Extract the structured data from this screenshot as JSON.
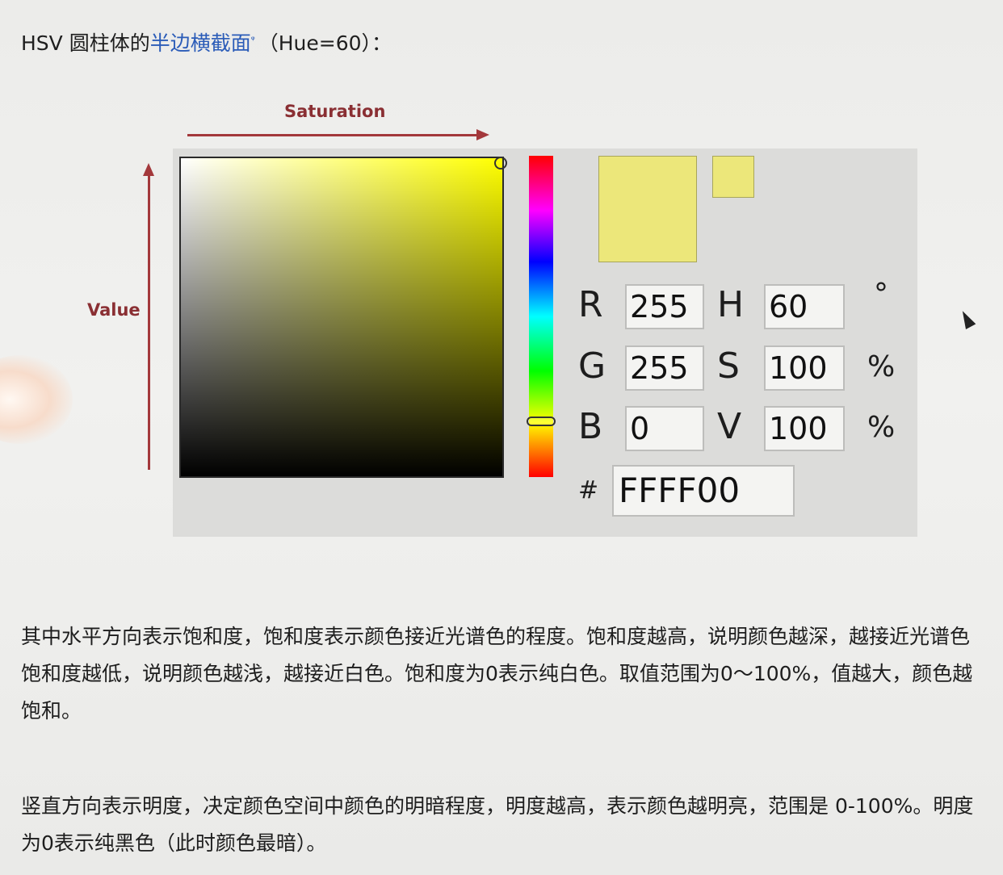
{
  "heading": {
    "prefix": "HSV 圆柱体的",
    "link_text": "半边横截面",
    "search_glyph": "ᵠ",
    "suffix": "（Hue=60）："
  },
  "diagram": {
    "saturation_label": "Saturation",
    "value_label": "Value"
  },
  "picker": {
    "color_hex": "#ece77a",
    "rgb": {
      "r_label": "R",
      "r_value": "255",
      "g_label": "G",
      "g_value": "255",
      "b_label": "B",
      "b_value": "0"
    },
    "hsv": {
      "h_label": "H",
      "h_value": "60",
      "h_unit": "°",
      "s_label": "S",
      "s_value": "100",
      "s_unit": "%",
      "v_label": "V",
      "v_value": "100",
      "v_unit": "%"
    },
    "hex_label": "#",
    "hex_value": "FFFF00"
  },
  "paragraphs": {
    "p1": "其中水平方向表示饱和度，饱和度表示颜色接近光谱色的程度。饱和度越高，说明颜色越深，越接近光谱色饱和度越低，说明颜色越浅，越接近白色。饱和度为0表示纯白色。取值范围为0～100%，值越大，颜色越饱和。",
    "p2": "竖直方向表示明度，决定颜色空间中颜色的明暗程度，明度越高，表示颜色越明亮，范围是 0-100%。明度为0表示纯黑色（此时颜色最暗）。"
  }
}
